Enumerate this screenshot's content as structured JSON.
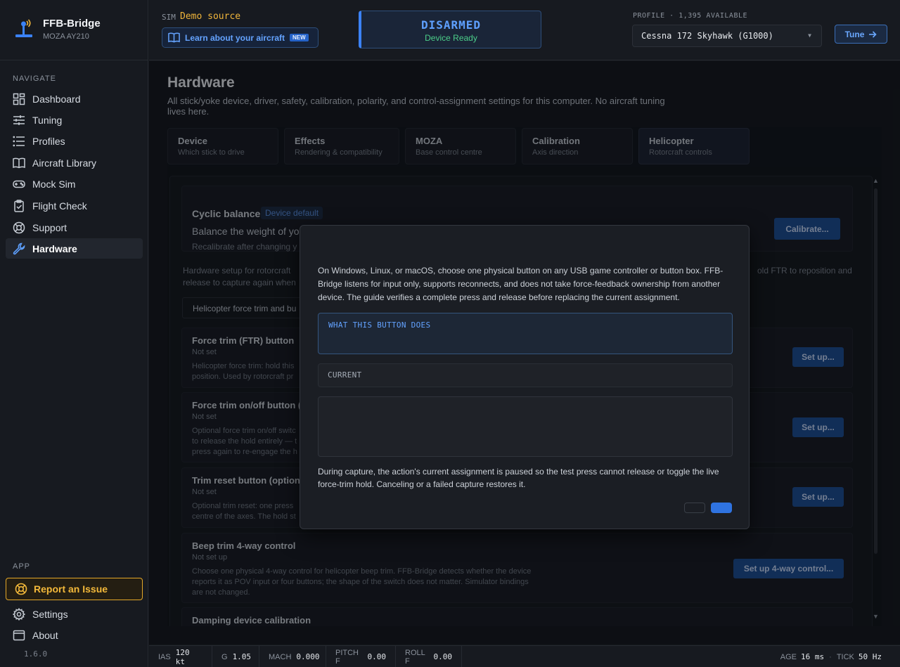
{
  "brand": {
    "name": "FFB-Bridge",
    "device": "MOZA AY210"
  },
  "sidebar": {
    "navigate_label": "NAVIGATE",
    "items": [
      {
        "label": "Dashboard",
        "icon": "dashboard-icon"
      },
      {
        "label": "Tuning",
        "icon": "sliders-icon"
      },
      {
        "label": "Profiles",
        "icon": "list-icon"
      },
      {
        "label": "Aircraft Library",
        "icon": "book-icon"
      },
      {
        "label": "Mock Sim",
        "icon": "gamepad-icon"
      },
      {
        "label": "Flight Check",
        "icon": "clipboard-check-icon"
      },
      {
        "label": "Support",
        "icon": "lifebuoy-icon"
      },
      {
        "label": "Hardware",
        "icon": "wrench-icon",
        "active": true
      }
    ],
    "app_label": "APP",
    "report_label": "Report an Issue",
    "settings_label": "Settings",
    "about_label": "About",
    "version": "1.6.0"
  },
  "topbar": {
    "sim_label": "SIM",
    "sim_value": "Demo source",
    "learn_label": "Learn about your aircraft",
    "new_badge": "NEW",
    "status_main": "DISARMED",
    "status_sub": "Device Ready",
    "profile_label": "PROFILE · 1,395 AVAILABLE",
    "profile_value": "Cessna 172 Skyhawk (G1000)",
    "tune_label": "Tune"
  },
  "page": {
    "title": "Hardware",
    "description": "All stick/yoke device, driver, safety, calibration, polarity, and control-assignment settings for this computer. No aircraft tuning lives here.",
    "tabs": [
      {
        "title": "Device",
        "subtitle": "Which stick to drive"
      },
      {
        "title": "Effects",
        "subtitle": "Rendering & compatibility"
      },
      {
        "title": "MOZA",
        "subtitle": "Base control centre"
      },
      {
        "title": "Calibration",
        "subtitle": "Axis direction"
      },
      {
        "title": "Helicopter",
        "subtitle": "Rotorcraft controls"
      }
    ]
  },
  "helicopter": {
    "cyclic_title": "Cyclic balance",
    "cyclic_badge": "Device default",
    "cyclic_desc": "Balance the weight of your grip or extension for helicopter flying.",
    "cyclic_note": "Recalibrate after changing y",
    "calibrate_label": "Calibrate...",
    "intro_text_left": "Hardware setup for rotorcraft",
    "intro_text_right": "old FTR to reposition and",
    "intro_text_line2": "release to capture again when",
    "section_header": "Helicopter force trim and bu",
    "rows": [
      {
        "title": "Force trim (FTR) button",
        "status": "Not set",
        "desc_1": "Helicopter force trim: hold this",
        "desc_2": "position. Used by rotorcraft pr",
        "button": "Set up..."
      },
      {
        "title": "Force trim on/off button (o",
        "status": "Not set",
        "desc_1": "Optional force trim on/off switc",
        "desc_2": "to release the hold entirely — t",
        "desc_3": "press again to re-engage the h",
        "button": "Set up..."
      },
      {
        "title": "Trim reset button (optiona",
        "status": "Not set",
        "desc_1": "Optional trim reset: one press",
        "desc_2": "centre of the axes. The hold st",
        "button": "Set up..."
      },
      {
        "title": "Beep trim 4-way control",
        "status": "Not set up",
        "desc_1": "Choose one physical 4-way control for helicopter beep trim. FFB-Bridge detects whether the device",
        "desc_2": "reports it as POV input or four buttons; the shape of the switch does not matter. Simulator bindings",
        "desc_3": "are not changed.",
        "button": "Set up 4-way control..."
      },
      {
        "title": "Damping device calibration"
      }
    ]
  },
  "modal": {
    "description": "On Windows, Linux, or macOS, choose one physical button on any USB game controller or button box. FFB-Bridge listens for input only, supports reconnects, and does not take force-feedback ownership from another device. The guide verifies a complete press and release before replacing the current assignment.",
    "field_what_label": "WHAT THIS BUTTON DOES",
    "field_current_label": "CURRENT",
    "note": "During capture, the action's current assignment is paused so the test press cannot release or toggle the live force-trim hold. Canceling or a failed capture restores it."
  },
  "statusbar": {
    "ias_label": "IAS",
    "ias_value": "120 kt",
    "g_label": "G",
    "g_value": "1.05",
    "mach_label": "MACH",
    "mach_value": "0.000",
    "pitch_label": "PITCH F",
    "pitch_value": "0.00",
    "roll_label": "ROLL F",
    "roll_value": "0.00",
    "age_label": "AGE",
    "age_value": "16 ms",
    "tick_label": "TICK",
    "tick_value": "50 Hz"
  },
  "colors": {
    "accent": "#3b82f6",
    "warning": "#e3a728",
    "success": "#4ccf8a",
    "background": "#14171c"
  }
}
